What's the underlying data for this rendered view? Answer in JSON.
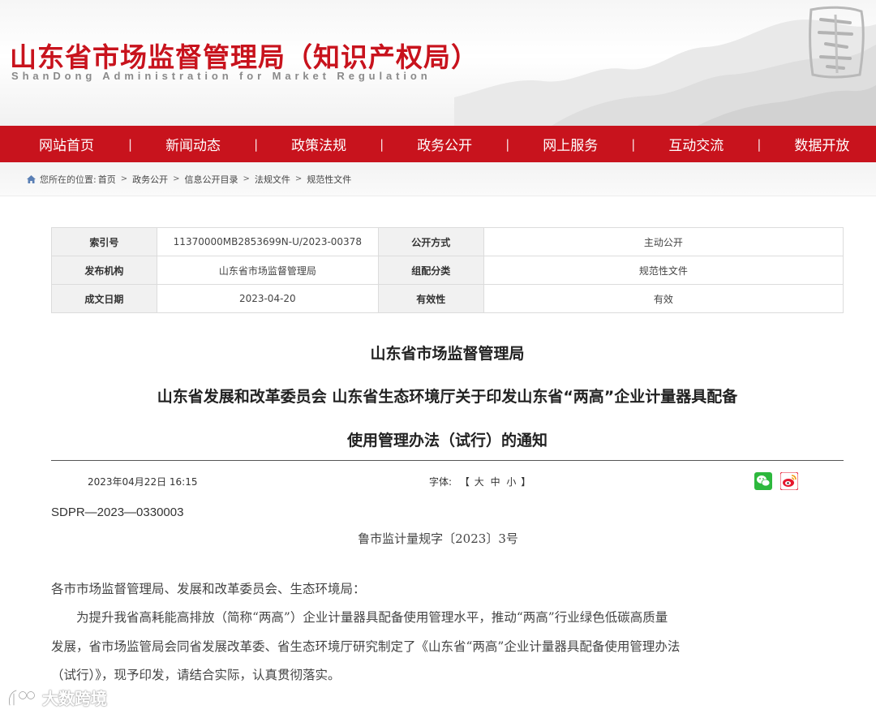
{
  "header": {
    "title": "山东省市场监督管理局（知识产权局）",
    "subtitle": "ShanDong Administration for Market Regulation"
  },
  "nav": {
    "items": [
      "网站首页",
      "新闻动态",
      "政策法规",
      "政务公开",
      "网上服务",
      "互动交流",
      "数据开放"
    ],
    "separator": "|"
  },
  "breadcrumb": {
    "prefix": "您所在的位置:",
    "items": [
      "首页",
      "政务公开",
      "信息公开目录",
      "法规文件",
      "规范性文件"
    ],
    "separator": ">"
  },
  "info_table": {
    "rows": [
      [
        {
          "label": "索引号"
        },
        {
          "value": "11370000MB2853699N-U/2023-00378"
        },
        {
          "label": "公开方式"
        },
        {
          "value": "主动公开"
        }
      ],
      [
        {
          "label": "发布机构"
        },
        {
          "value": "山东省市场监督管理局"
        },
        {
          "label": "组配分类"
        },
        {
          "value": "规范性文件"
        }
      ],
      [
        {
          "label": "成文日期"
        },
        {
          "value": "2023-04-20"
        },
        {
          "label": "有效性"
        },
        {
          "value": "有效"
        }
      ]
    ]
  },
  "article": {
    "title_lines": [
      "山东省市场监督管理局",
      "山东省发展和改革委员会 山东省生态环境厅关于印发山东省“两高”企业计量器具配备",
      "使用管理办法（试行）的通知"
    ],
    "date": "2023年04月22日 16:15",
    "font_label": "字体:",
    "font_bracket_open": "【",
    "font_sizes": [
      "大",
      "中",
      "小"
    ],
    "font_bracket_close": "】",
    "share_icons": [
      "wechat-icon",
      "weibo-icon"
    ],
    "sdpr": "SDPR—2023—0330003",
    "doc_number": "鲁市监计量规字〔2023〕3号",
    "body_lines": [
      "各市市场监督管理局、发展和改革委员会、生态环境局：",
      "　　为提升我省高耗能高排放（简称“两高”）企业计量器具配备使用管理水平，推动“两高”行业绿色低碳高质量",
      "发展，省市场监管局会同省发展改革委、省生态环境厅研究制定了《山东省“两高”企业计量器具配备使用管理办法",
      "（试行）》，现予印发，请结合实际，认真贯彻落实。"
    ]
  },
  "watermark": {
    "text": "大数跨境"
  },
  "colors": {
    "brand_red": "#c8131d",
    "nav_text": "#ffffff",
    "table_label_bg": "#f1f1f1"
  }
}
